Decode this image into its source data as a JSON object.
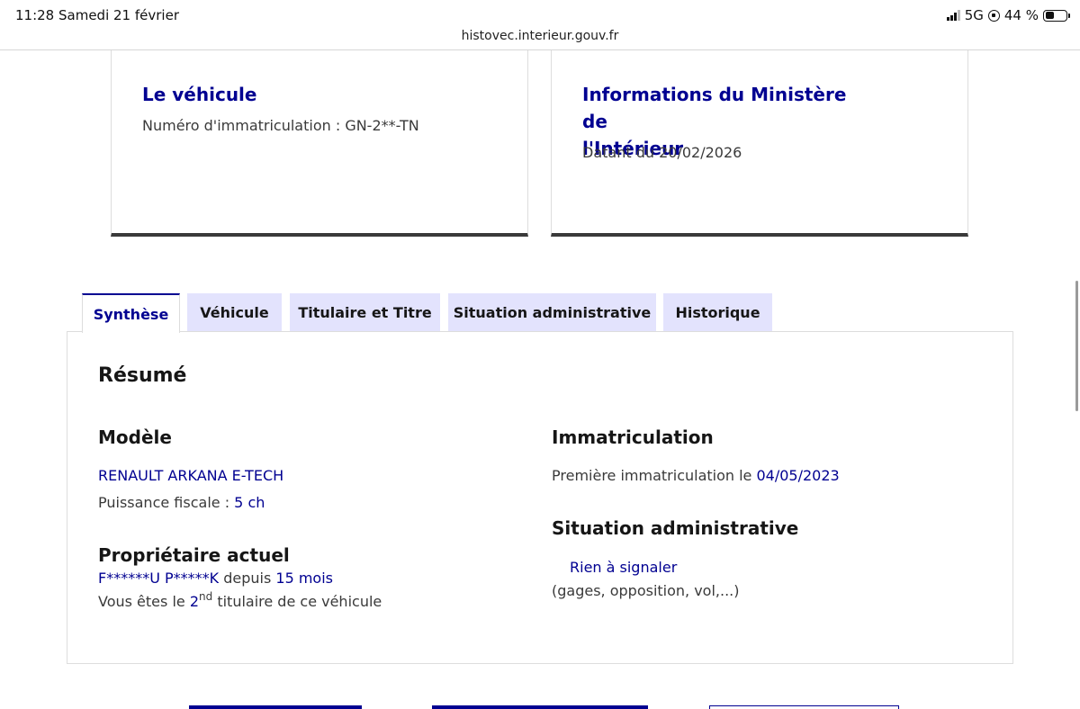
{
  "status_bar": {
    "time": "11:28",
    "date": "Samedi 21 février",
    "network": "5G",
    "battery": "44 %",
    "battery_level": 0.44
  },
  "browser": {
    "url": "histovec.interieur.gouv.fr"
  },
  "vehicle_card": {
    "title": "Le véhicule",
    "plate_text": "Numéro d'immatriculation : GN-2**-TN"
  },
  "ministry_card": {
    "title_line1": "Informations du Ministère de",
    "title_line2": "l'Intérieur",
    "date_text": "Datant du 20/02/2026"
  },
  "tabs": [
    {
      "label": "Synthèse",
      "active": true
    },
    {
      "label": "Véhicule",
      "active": false
    },
    {
      "label": "Titulaire et Titre",
      "active": false
    },
    {
      "label": "Situation administrative",
      "active": false
    },
    {
      "label": "Historique",
      "active": false
    }
  ],
  "summary": {
    "heading": "Résumé",
    "model": {
      "heading": "Modèle",
      "name": "RENAULT ARKANA E-TECH",
      "power_label": "Puissance fiscale : ",
      "power_value": "5 ch"
    },
    "owner": {
      "heading": "Propriétaire actuel",
      "name": "F******U P*****K",
      "since_label": " depuis ",
      "since_value": "15 mois",
      "rank_prefix": "Vous êtes le ",
      "rank_number": "2",
      "rank_suffix": "nd",
      "rank_rest": " titulaire de ce véhicule"
    },
    "registration": {
      "heading": "Immatriculation",
      "first_label": "Première immatriculation le ",
      "first_date": "04/05/2023"
    },
    "admin": {
      "heading": "Situation administrative",
      "status": "Rien à signaler",
      "details": "(gages, opposition, vol,...)"
    }
  },
  "colors": {
    "primary_blue": "#000091",
    "tab_background": "#e3e3fd",
    "text": "#3a3a3a"
  }
}
